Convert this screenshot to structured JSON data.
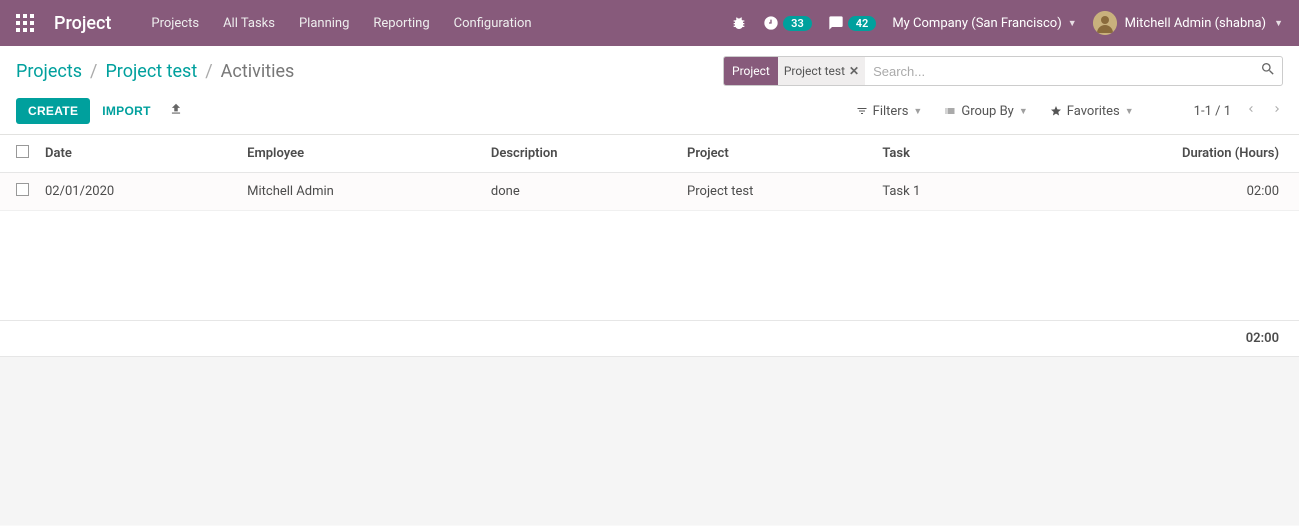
{
  "navbar": {
    "brand": "Project",
    "menu": [
      "Projects",
      "All Tasks",
      "Planning",
      "Reporting",
      "Configuration"
    ],
    "activities_count": "33",
    "messages_count": "42",
    "company": "My Company (San Francisco)",
    "user": "Mitchell Admin (shabna)"
  },
  "breadcrumb": {
    "level1": "Projects",
    "level2": "Project test",
    "level3": "Activities"
  },
  "search": {
    "facet_label": "Project",
    "facet_value": "Project test",
    "placeholder": "Search..."
  },
  "buttons": {
    "create": "CREATE",
    "import": "IMPORT"
  },
  "search_options": {
    "filters": "Filters",
    "group_by": "Group By",
    "favorites": "Favorites"
  },
  "pager": {
    "value": "1-1 / 1"
  },
  "table": {
    "headers": {
      "date": "Date",
      "employee": "Employee",
      "description": "Description",
      "project": "Project",
      "task": "Task",
      "duration": "Duration (Hours)"
    },
    "rows": [
      {
        "date": "02/01/2020",
        "employee": "Mitchell Admin",
        "description": "done",
        "project": "Project test",
        "task": "Task 1",
        "duration": "02:00"
      }
    ],
    "total_duration": "02:00"
  }
}
